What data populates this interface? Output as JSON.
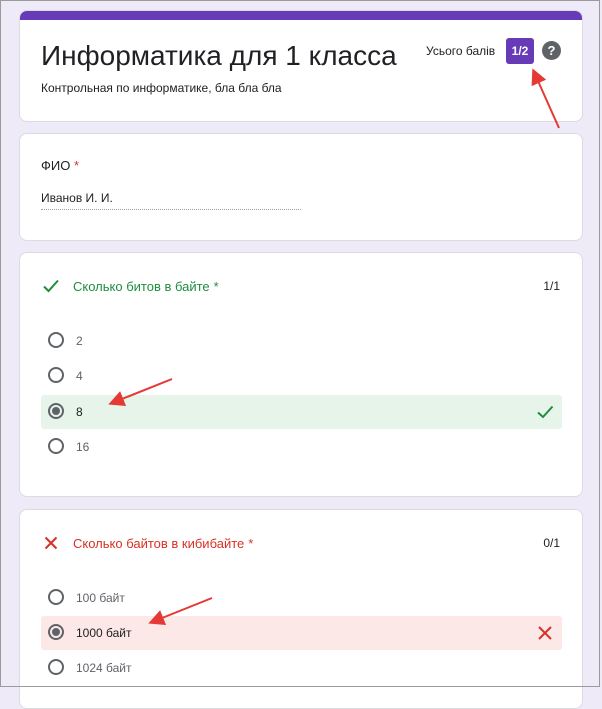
{
  "header": {
    "title": "Информатика для 1 класса",
    "description": "Контрольная по информатике, бла бла бла",
    "total_label": "Усього балів",
    "score": "1/2",
    "help_glyph": "?"
  },
  "name_question": {
    "label": "ФИО",
    "required_mark": "*",
    "value": "Иванов И. И."
  },
  "questions": [
    {
      "title": "Сколько битов в байте",
      "required_mark": "*",
      "points": "1/1",
      "status": "correct",
      "options": [
        "2",
        "4",
        "8",
        "16"
      ],
      "selected": "8"
    },
    {
      "title": "Сколько байтов в кибибайте",
      "required_mark": "*",
      "points": "0/1",
      "status": "wrong",
      "options": [
        "100 байт",
        "1000 байт",
        "1024 байт"
      ],
      "selected": "1000 байт"
    }
  ],
  "colors": {
    "accent": "#673ab7",
    "correct": "#1e8e3e",
    "wrong": "#d93025",
    "correct_bg": "#e6f4ea",
    "wrong_bg": "#fce8e6",
    "annotation_arrow": "#e53935"
  },
  "icons": {
    "help": "help-icon",
    "correct": "check-icon",
    "wrong": "close-icon"
  }
}
